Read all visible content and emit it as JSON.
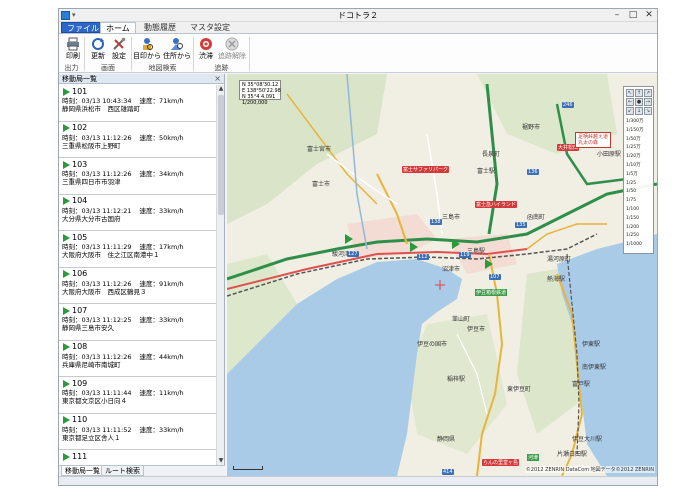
{
  "window": {
    "title": "ドコトラ２"
  },
  "tabs": [
    {
      "label": "ファイル"
    },
    {
      "label": "ホーム"
    },
    {
      "label": "動態履歴"
    },
    {
      "label": "マスタ設定"
    }
  ],
  "ribbon": {
    "buttons": [
      {
        "label": "印刷"
      },
      {
        "label": "更新"
      },
      {
        "label": "設定"
      },
      {
        "label": "目印から"
      },
      {
        "label": "住所から"
      },
      {
        "label": "渋滞"
      },
      {
        "label": "追跡解除"
      }
    ],
    "groups": [
      {
        "label": "出力"
      },
      {
        "label": "画面"
      },
      {
        "label": "地図検索"
      },
      {
        "label": "追跡"
      }
    ]
  },
  "left_pane": {
    "title": "移動局一覧",
    "time_prefix": "時刻：",
    "speed_prefix": "速度：",
    "vehicles": [
      {
        "id": "101",
        "time": "03/13 10:43:34",
        "speed": "71km/h",
        "address": "静岡県浜松市　西区雄踏町"
      },
      {
        "id": "102",
        "time": "03/13 11:12:26",
        "speed": "50km/h",
        "address": "三重県松阪市上野町"
      },
      {
        "id": "103",
        "time": "03/13 11:12:26",
        "speed": "34km/h",
        "address": "三重県四日市市羽津"
      },
      {
        "id": "104",
        "time": "03/13 11:12:21",
        "speed": "33km/h",
        "address": "大分県大分市古国府"
      },
      {
        "id": "105",
        "time": "03/13 11:11:29",
        "speed": "17km/h",
        "address": "大阪府大阪市　住之江区南港中１"
      },
      {
        "id": "106",
        "time": "03/13 11:12:26",
        "speed": "91km/h",
        "address": "大阪府大阪市　西成区鶴見３"
      },
      {
        "id": "107",
        "time": "03/13 11:12:25",
        "speed": "33km/h",
        "address": "静岡県三島市安久"
      },
      {
        "id": "108",
        "time": "03/13 11:12:26",
        "speed": "44km/h",
        "address": "兵庫県尼崎市南城町"
      },
      {
        "id": "109",
        "time": "03/13 11:11:44",
        "speed": "11km/h",
        "address": "東京都文京区小日向４"
      },
      {
        "id": "110",
        "time": "03/13 11:11:52",
        "speed": "33km/h",
        "address": "東京都足立区舎人１"
      },
      {
        "id": "111",
        "time": "",
        "speed": "",
        "address": ""
      }
    ],
    "bottom_tabs": [
      {
        "label": "移動局一覧"
      },
      {
        "label": "ルート検索"
      }
    ]
  },
  "map": {
    "coord_box": "N 35°08'30.12\nE 138°50'22.98\nN 35°4 4.091\n1/200,000",
    "labels": [
      {
        "text": "富士宮市"
      },
      {
        "text": "富士市"
      },
      {
        "text": "沼津市"
      },
      {
        "text": "三島駅"
      },
      {
        "text": "富士駅"
      },
      {
        "text": "小田原駅"
      },
      {
        "text": "熱海駅"
      },
      {
        "text": "伊東駅"
      },
      {
        "text": "静岡県"
      },
      {
        "text": "伊豆大川駅"
      },
      {
        "text": "片瀬白田駅"
      },
      {
        "text": "稲梓駅"
      },
      {
        "text": "富戸駅"
      },
      {
        "text": "南伊東駅"
      },
      {
        "text": "伊豆市"
      },
      {
        "text": "韮山町"
      },
      {
        "text": "長泉町"
      },
      {
        "text": "裾野市"
      },
      {
        "text": "函南町"
      },
      {
        "text": "湯河原町"
      },
      {
        "text": "伊豆の国市"
      },
      {
        "text": "駿河湾"
      },
      {
        "text": "三島市"
      },
      {
        "text": "東伊豆町"
      }
    ],
    "pois": [
      {
        "text": "富士サファリパーク"
      },
      {
        "text": "富士急ハイランド"
      },
      {
        "text": "大井松田"
      },
      {
        "text": "伊豆箱根鉄道"
      },
      {
        "text": "らんの里堂ヶ島"
      },
      {
        "text": "河津"
      }
    ],
    "info_box": "足柄峠越え道\n丸太の森",
    "routes": [
      {
        "text": "127"
      },
      {
        "text": "112"
      },
      {
        "text": "119"
      },
      {
        "text": "107"
      },
      {
        "text": "138"
      },
      {
        "text": "135"
      },
      {
        "text": "414"
      },
      {
        "text": "136"
      },
      {
        "text": "246"
      }
    ],
    "scale_levels": [
      "1/300万",
      "1/150万",
      "1/50万",
      "1/25万",
      "1/20万",
      "1/10万",
      "1/5万",
      "1/25",
      "1/50",
      "1/75",
      "1/100",
      "1/150",
      "1/200",
      "1/250",
      "1/1000"
    ],
    "zoom_buttons": [
      "↖",
      "↑",
      "↗",
      "←",
      "●",
      "→",
      "↙",
      "↓",
      "↘"
    ],
    "copyright": "©2012 ZENRIN DataCom 地図データ©2012 ZENRIN"
  }
}
